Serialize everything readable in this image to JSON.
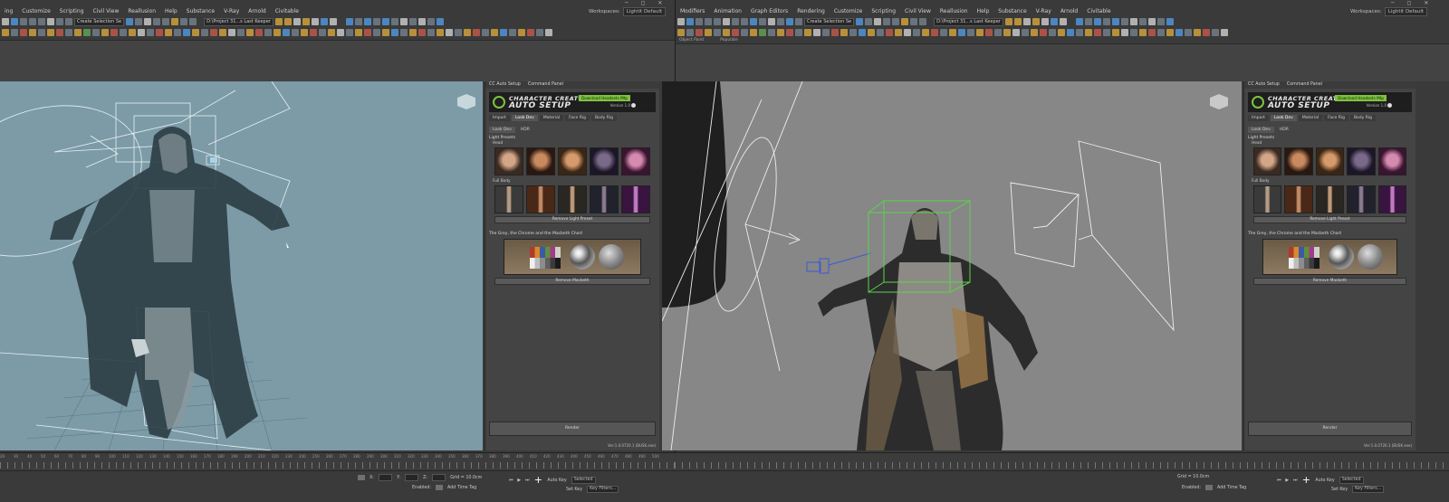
{
  "left": {
    "menu": [
      "ing",
      "Customize",
      "Scripting",
      "Civil View",
      "Reallusion",
      "Help",
      "Substance",
      "V-Ray",
      "Arnold",
      "Civitable"
    ],
    "selection_set": "Create Selection Se",
    "project": "D:\\Project 31...s Last Keeper",
    "workspaces_label": "Workspaces:",
    "workspace_value": "Lightit Default",
    "panel": {
      "tabs": [
        "CC Auto Setup",
        "Command Panel"
      ],
      "banner_line1": "CHARACTER CREATOR",
      "banner_line2": "AUTO SETUP",
      "badge": "Download  Headsets  Mtp",
      "version": "Version 1.0",
      "subtabs": [
        "Import",
        "Look Dev",
        "Material",
        "Face Rig",
        "Body Rig"
      ],
      "subsub": [
        "Look Dev",
        "HDR"
      ],
      "light_presets": "Light Presets",
      "head": "Head",
      "full_body": "Full Body",
      "remove_light": "Remove Light Preset",
      "grey_chrome": "The Grey, the Chrome and the Macbeth Chart",
      "remove_macbeth": "Remove Macbeth",
      "render": "Render",
      "ver": "Ver:1.0.0720.1 (BUSK.exe)"
    },
    "status": {
      "x": "X:",
      "y": "Y:",
      "z": "Z:",
      "grid": "Grid = 10.0cm",
      "enabled": "Enabled:",
      "add_time_tag": "Add Time Tag",
      "auto_key": "Auto Key",
      "selected": "Selected",
      "set_key": "Set Key",
      "key_filters": "Key Filters..."
    },
    "timeline_nums": [
      "20",
      "30",
      "40",
      "50",
      "60",
      "70",
      "80",
      "90",
      "100",
      "110",
      "120",
      "130",
      "140",
      "150",
      "160",
      "170",
      "180",
      "190",
      "200",
      "210",
      "220",
      "230",
      "240",
      "250",
      "260",
      "270",
      "280",
      "290",
      "300",
      "310",
      "320",
      "330",
      "340",
      "350",
      "360",
      "370",
      "380",
      "390",
      "400",
      "410",
      "420",
      "430",
      "440",
      "450",
      "460",
      "470",
      "480",
      "490",
      "500"
    ]
  },
  "right": {
    "menu": [
      "Modifiers",
      "Animation",
      "Graph Editors",
      "Rendering",
      "Customize",
      "Scripting",
      "Civil View",
      "Reallusion",
      "Help",
      "Substance",
      "V-Ray",
      "Arnold",
      "Civitable"
    ],
    "selection_set": "Create Selection Se",
    "project": "D:\\Project 31...s Last Keeper",
    "workspaces_label": "Workspaces:",
    "workspace_value": "Lightit Default",
    "props": [
      "Object Paint",
      "Populate"
    ],
    "panel": {
      "tabs": [
        "CC Auto Setup",
        "Command Panel"
      ],
      "banner_line1": "CHARACTER CREATOR",
      "banner_line2": "AUTO SETUP",
      "badge": "Download  Headsets  Mtp",
      "version": "Version 1.0",
      "subtabs": [
        "Import",
        "Look Dev",
        "Material",
        "Face Rig",
        "Body Rig"
      ],
      "subsub": [
        "Look Dev",
        "HDR"
      ],
      "light_presets": "Light Presets",
      "head": "Head",
      "full_body": "Full Body",
      "remove_light": "Remove Light Preset",
      "grey_chrome": "The Grey, the Chrome and the Macbeth Chart",
      "remove_macbeth": "Remove Macbeth",
      "render": "Render",
      "ver": "Ver:1.0.0720.1 (BUSK.exe)"
    },
    "status": {
      "grid": "Grid = 10.0cm",
      "enabled": "Enabled:",
      "add_time_tag": "Add Time Tag",
      "auto_key": "Auto Key",
      "selected": "Selected",
      "set_key": "Set Key",
      "key_filters": "Key Filters..."
    }
  },
  "colors": {
    "accent_green": "#7fc241",
    "viewport_left": "#7c9ba7",
    "viewport_right": "#878787"
  }
}
